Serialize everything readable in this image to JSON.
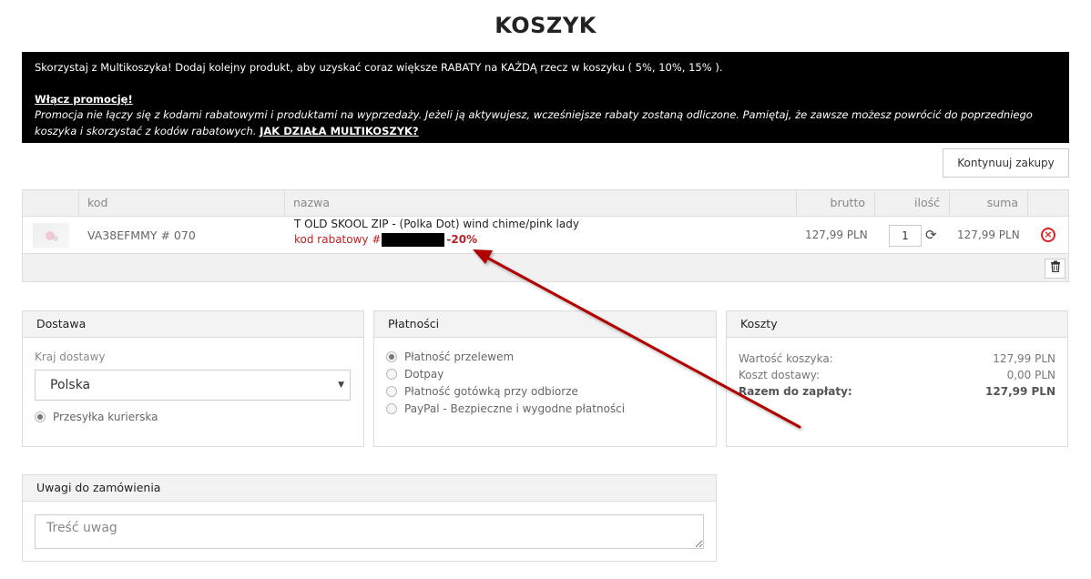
{
  "page": {
    "title": "KOSZYK"
  },
  "promo": {
    "line1": "Skorzystaj z Multikoszyka! Dodaj kolejny produkt, aby uzyskać coraz większe RABATY na KAŻDĄ rzecz w koszyku ( 5%, 10%, 15% ).",
    "enable_link": "Włącz promocję!",
    "description": "Promocja nie łączy się z kodami rabatowymi i produktami na wyprzedaży. Jeżeli ją aktywujesz, wcześniejsze rabaty zostaną odliczone. Pamiętaj, że zawsze możesz powrócić do poprzedniego koszyka i skorzystać z kodów rabatowych.",
    "how_link": "JAK DZIAŁA MULTIKOSZYK?"
  },
  "continue_label": "Kontynuuj zakupy",
  "cart": {
    "headers": {
      "code": "kod",
      "name": "nazwa",
      "gross": "brutto",
      "qty": "ilość",
      "sum": "suma"
    },
    "items": [
      {
        "code": "VA38EFMMY # 070",
        "name": "T OLD SKOOL ZIP - (Polka Dot) wind chime/pink lady",
        "discount_label": "kod rabatowy #",
        "discount_value": "-20%",
        "gross": "127,99 PLN",
        "qty": "1",
        "sum": "127,99 PLN"
      }
    ]
  },
  "delivery": {
    "title": "Dostawa",
    "country_label": "Kraj dostawy",
    "country_value": "Polska",
    "method": "Przesyłka kurierska"
  },
  "payment": {
    "title": "Płatności",
    "options": [
      "Płatność przelewem",
      "Dotpay",
      "Płatność gotówką przy odbiorze",
      "PayPal - Bezpieczne i wygodne płatności"
    ]
  },
  "costs": {
    "title": "Koszty",
    "cart_value_label": "Wartość koszyka:",
    "cart_value": "127,99 PLN",
    "shipping_label": "Koszt dostawy:",
    "shipping_value": "0,00 PLN",
    "total_label": "Razem do zapłaty:",
    "total_value": "127,99 PLN"
  },
  "notes": {
    "title": "Uwagi do zamówienia",
    "placeholder": "Treść uwag"
  },
  "colors": {
    "discount": "#b22222",
    "annotation_arrow": "#b00000"
  }
}
